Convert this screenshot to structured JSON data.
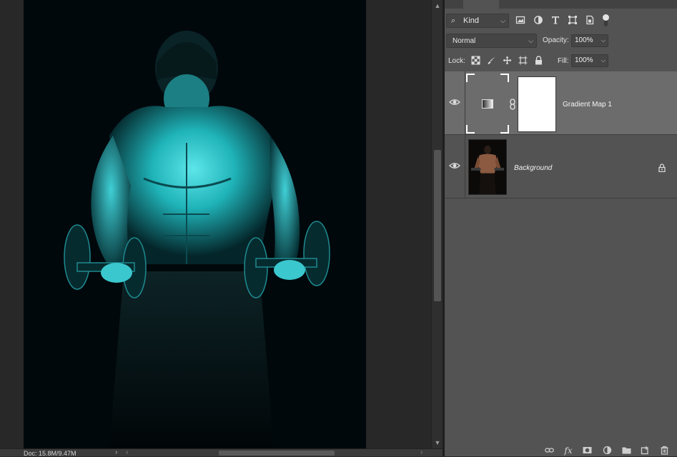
{
  "canvas": {
    "image_alt": "Muscular man holding dumbbells with a cyan gradient map applied"
  },
  "status_bar": {
    "doc_info": "Doc: 15.8M/9.47M"
  },
  "layers_panel": {
    "filter": {
      "kind_label": "Kind",
      "icons": [
        "image-filter-icon",
        "adjustment-filter-icon",
        "type-filter-icon",
        "shape-filter-icon",
        "smart-object-filter-icon"
      ]
    },
    "blend_mode": "Normal",
    "opacity_label": "Opacity:",
    "opacity_value": "100%",
    "lock_label": "Lock:",
    "fill_label": "Fill:",
    "fill_value": "100%",
    "layers": [
      {
        "name": "Gradient Map 1",
        "type": "adjustment",
        "visible": true,
        "selected": true
      },
      {
        "name": "Background",
        "type": "pixel",
        "visible": true,
        "locked": true,
        "selected": false
      }
    ]
  },
  "colors": {
    "canvas_bg": "#282828",
    "document_bg": "#01080c",
    "tint": "#2ad4d8",
    "panel_bg": "#535353",
    "selected_layer_bg": "#6c6c6c"
  }
}
